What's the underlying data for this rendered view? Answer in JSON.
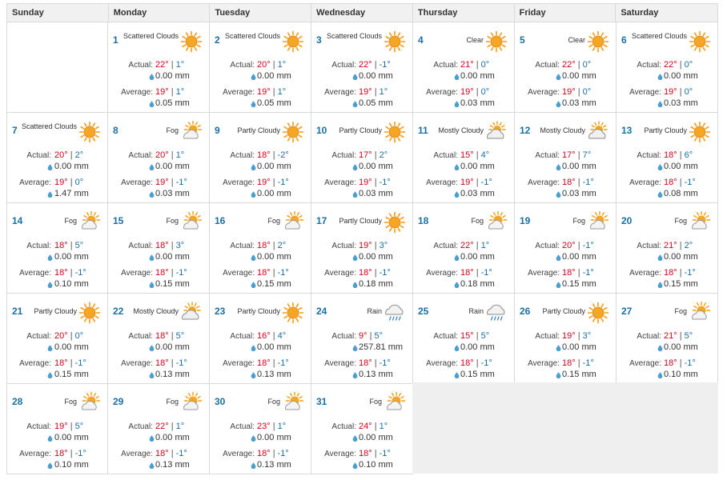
{
  "weekdays": [
    "Sunday",
    "Monday",
    "Tuesday",
    "Wednesday",
    "Thursday",
    "Friday",
    "Saturday"
  ],
  "labels": {
    "actual": "Actual:",
    "average": "Average:",
    "unit": "mm"
  },
  "colors": {
    "high": "#d0021b",
    "low": "#1a6fa3",
    "day_number": "#1a6fa3",
    "drop": "#4a9fd0"
  },
  "days": [
    {
      "n": "1",
      "cond": "Scattered Clouds",
      "icon": "sunny-icon",
      "a_hi": "22°",
      "a_lo": "1°",
      "a_mm": "0.00",
      "v_hi": "19°",
      "v_lo": "1°",
      "v_mm": "0.05"
    },
    {
      "n": "2",
      "cond": "Scattered Clouds",
      "icon": "sunny-icon",
      "a_hi": "20°",
      "a_lo": "1°",
      "a_mm": "0.00",
      "v_hi": "19°",
      "v_lo": "1°",
      "v_mm": "0.05"
    },
    {
      "n": "3",
      "cond": "Scattered Clouds",
      "icon": "sunny-icon",
      "a_hi": "22°",
      "a_lo": "-1°",
      "a_mm": "0.00",
      "v_hi": "19°",
      "v_lo": "1°",
      "v_mm": "0.05"
    },
    {
      "n": "4",
      "cond": "Clear",
      "icon": "sunny-icon",
      "a_hi": "21°",
      "a_lo": "0°",
      "a_mm": "0.00",
      "v_hi": "19°",
      "v_lo": "0°",
      "v_mm": "0.03"
    },
    {
      "n": "5",
      "cond": "Clear",
      "icon": "sunny-icon",
      "a_hi": "22°",
      "a_lo": "0°",
      "a_mm": "0.00",
      "v_hi": "19°",
      "v_lo": "0°",
      "v_mm": "0.03"
    },
    {
      "n": "6",
      "cond": "Scattered Clouds",
      "icon": "sunny-icon",
      "a_hi": "22°",
      "a_lo": "0°",
      "a_mm": "0.00",
      "v_hi": "19°",
      "v_lo": "0°",
      "v_mm": "0.03"
    },
    {
      "n": "7",
      "cond": "Scattered Clouds",
      "icon": "sunny-icon",
      "a_hi": "20°",
      "a_lo": "2°",
      "a_mm": "0.00",
      "v_hi": "19°",
      "v_lo": "0°",
      "v_mm": "1.47"
    },
    {
      "n": "8",
      "cond": "Fog",
      "icon": "fog-icon",
      "a_hi": "20°",
      "a_lo": "1°",
      "a_mm": "0.00",
      "v_hi": "19°",
      "v_lo": "-1°",
      "v_mm": "0.03"
    },
    {
      "n": "9",
      "cond": "Partly Cloudy",
      "icon": "sunny-icon",
      "a_hi": "18°",
      "a_lo": "-2°",
      "a_mm": "0.00",
      "v_hi": "19°",
      "v_lo": "-1°",
      "v_mm": "0.00"
    },
    {
      "n": "10",
      "cond": "Partly Cloudy",
      "icon": "sunny-icon",
      "a_hi": "17°",
      "a_lo": "2°",
      "a_mm": "0.00",
      "v_hi": "19°",
      "v_lo": "-1°",
      "v_mm": "0.03"
    },
    {
      "n": "11",
      "cond": "Mostly Cloudy",
      "icon": "partly-cloudy-icon",
      "a_hi": "15°",
      "a_lo": "4°",
      "a_mm": "0.00",
      "v_hi": "19°",
      "v_lo": "-1°",
      "v_mm": "0.03"
    },
    {
      "n": "12",
      "cond": "Mostly Cloudy",
      "icon": "partly-cloudy-icon",
      "a_hi": "17°",
      "a_lo": "7°",
      "a_mm": "0.00",
      "v_hi": "18°",
      "v_lo": "-1°",
      "v_mm": "0.03"
    },
    {
      "n": "13",
      "cond": "Partly Cloudy",
      "icon": "sunny-icon",
      "a_hi": "18°",
      "a_lo": "6°",
      "a_mm": "0.00",
      "v_hi": "18°",
      "v_lo": "-1°",
      "v_mm": "0.08"
    },
    {
      "n": "14",
      "cond": "Fog",
      "icon": "fog-icon",
      "a_hi": "18°",
      "a_lo": "5°",
      "a_mm": "0.00",
      "v_hi": "18°",
      "v_lo": "-1°",
      "v_mm": "0.10"
    },
    {
      "n": "15",
      "cond": "Fog",
      "icon": "fog-icon",
      "a_hi": "18°",
      "a_lo": "3°",
      "a_mm": "0.00",
      "v_hi": "18°",
      "v_lo": "-1°",
      "v_mm": "0.15"
    },
    {
      "n": "16",
      "cond": "Fog",
      "icon": "fog-icon",
      "a_hi": "18°",
      "a_lo": "2°",
      "a_mm": "0.00",
      "v_hi": "18°",
      "v_lo": "-1°",
      "v_mm": "0.15"
    },
    {
      "n": "17",
      "cond": "Partly Cloudy",
      "icon": "sunny-icon",
      "a_hi": "19°",
      "a_lo": "3°",
      "a_mm": "0.00",
      "v_hi": "18°",
      "v_lo": "-1°",
      "v_mm": "0.18"
    },
    {
      "n": "18",
      "cond": "Fog",
      "icon": "fog-icon",
      "a_hi": "22°",
      "a_lo": "1°",
      "a_mm": "0.00",
      "v_hi": "18°",
      "v_lo": "-1°",
      "v_mm": "0.18"
    },
    {
      "n": "19",
      "cond": "Fog",
      "icon": "fog-icon",
      "a_hi": "20°",
      "a_lo": "-1°",
      "a_mm": "0.00",
      "v_hi": "18°",
      "v_lo": "-1°",
      "v_mm": "0.15"
    },
    {
      "n": "20",
      "cond": "Fog",
      "icon": "fog-icon",
      "a_hi": "21°",
      "a_lo": "2°",
      "a_mm": "0.00",
      "v_hi": "18°",
      "v_lo": "-1°",
      "v_mm": "0.15"
    },
    {
      "n": "21",
      "cond": "Partly Cloudy",
      "icon": "sunny-icon",
      "a_hi": "20°",
      "a_lo": "0°",
      "a_mm": "0.00",
      "v_hi": "18°",
      "v_lo": "-1°",
      "v_mm": "0.15"
    },
    {
      "n": "22",
      "cond": "Mostly Cloudy",
      "icon": "partly-cloudy-icon",
      "a_hi": "18°",
      "a_lo": "5°",
      "a_mm": "0.00",
      "v_hi": "18°",
      "v_lo": "-1°",
      "v_mm": "0.13"
    },
    {
      "n": "23",
      "cond": "Partly Cloudy",
      "icon": "sunny-icon",
      "a_hi": "16°",
      "a_lo": "4°",
      "a_mm": "0.00",
      "v_hi": "18°",
      "v_lo": "-1°",
      "v_mm": "0.13"
    },
    {
      "n": "24",
      "cond": "Rain",
      "icon": "rain-icon",
      "a_hi": "9°",
      "a_lo": "5°",
      "a_mm": "257.81",
      "v_hi": "18°",
      "v_lo": "-1°",
      "v_mm": "0.13"
    },
    {
      "n": "25",
      "cond": "Rain",
      "icon": "rain-icon",
      "a_hi": "15°",
      "a_lo": "5°",
      "a_mm": "0.00",
      "v_hi": "18°",
      "v_lo": "-1°",
      "v_mm": "0.15"
    },
    {
      "n": "26",
      "cond": "Partly Cloudy",
      "icon": "sunny-icon",
      "a_hi": "19°",
      "a_lo": "3°",
      "a_mm": "0.00",
      "v_hi": "18°",
      "v_lo": "-1°",
      "v_mm": "0.15"
    },
    {
      "n": "27",
      "cond": "Fog",
      "icon": "fog-icon",
      "a_hi": "21°",
      "a_lo": "5°",
      "a_mm": "0.00",
      "v_hi": "18°",
      "v_lo": "-1°",
      "v_mm": "0.10"
    },
    {
      "n": "28",
      "cond": "Fog",
      "icon": "fog-icon",
      "a_hi": "19°",
      "a_lo": "5°",
      "a_mm": "0.00",
      "v_hi": "18°",
      "v_lo": "-1°",
      "v_mm": "0.10"
    },
    {
      "n": "29",
      "cond": "Fog",
      "icon": "fog-icon",
      "a_hi": "22°",
      "a_lo": "1°",
      "a_mm": "0.00",
      "v_hi": "18°",
      "v_lo": "-1°",
      "v_mm": "0.13"
    },
    {
      "n": "30",
      "cond": "Fog",
      "icon": "fog-icon",
      "a_hi": "23°",
      "a_lo": "1°",
      "a_mm": "0.00",
      "v_hi": "18°",
      "v_lo": "-1°",
      "v_mm": "0.13"
    },
    {
      "n": "31",
      "cond": "Fog",
      "icon": "fog-icon",
      "a_hi": "24°",
      "a_lo": "1°",
      "a_mm": "0.00",
      "v_hi": "18°",
      "v_lo": "-1°",
      "v_mm": "0.10"
    }
  ]
}
